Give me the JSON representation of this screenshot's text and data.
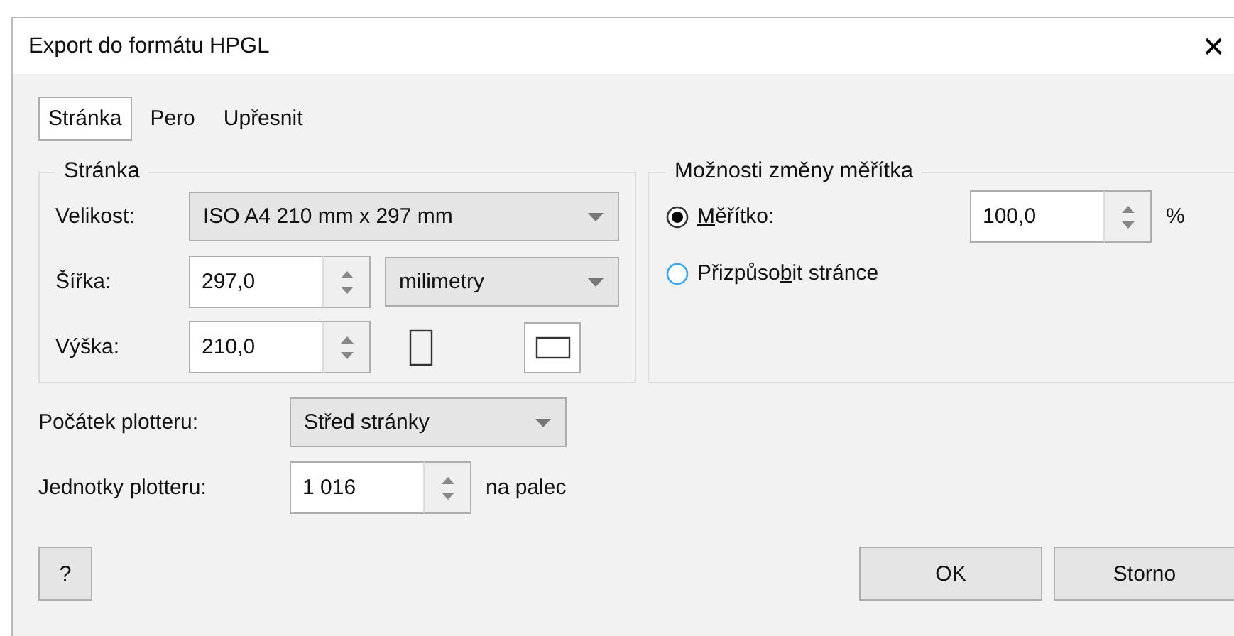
{
  "window": {
    "title": "Export do formátu HPGL",
    "close": "✕"
  },
  "tabs": [
    {
      "label": "Stránka",
      "selected": true
    },
    {
      "label": "Pero",
      "selected": false
    },
    {
      "label": "Upřesnit",
      "selected": false
    }
  ],
  "page_group": {
    "title": "Stránka",
    "size": {
      "label": "Velikost:",
      "value": "ISO A4 210 mm x 297 mm"
    },
    "width": {
      "label": "Šířka:",
      "value": "297,0",
      "unit": "milimetry"
    },
    "height": {
      "label": "Výška:",
      "value": "210,0"
    },
    "orientation": [
      {
        "kind": "portrait",
        "selected": false
      },
      {
        "kind": "landscape",
        "selected": true
      }
    ]
  },
  "scale_group": {
    "title": "Možnosti změny měřítka",
    "options": [
      {
        "access_key": "M",
        "label_end": "ěřítko:",
        "selected": true,
        "value": "100,0",
        "unit": "%"
      },
      {
        "label_start": "Přizpůso",
        "access_key": "b",
        "label_end": "it stránce",
        "selected": false
      }
    ]
  },
  "plotter_origin": {
    "label": "Počátek plotteru:",
    "value": "Střed stránky"
  },
  "plotter_units": {
    "label": "Jednotky plotteru:",
    "value": "1 016",
    "unit": "na palec"
  },
  "buttons": {
    "help": "?",
    "ok": "OK",
    "cancel": "Storno"
  }
}
